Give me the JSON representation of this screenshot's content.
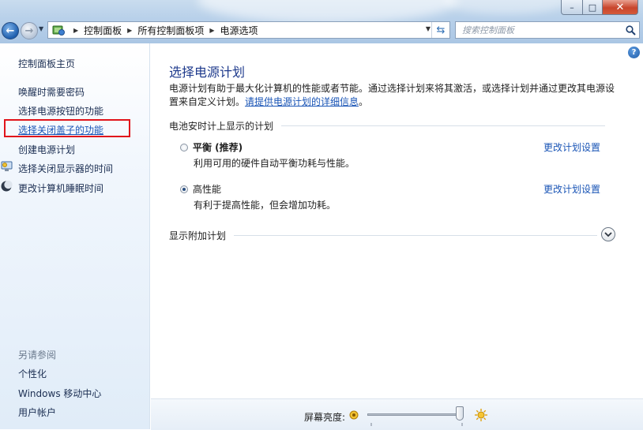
{
  "window": {
    "minimize_label": "–",
    "maximize_label": "□",
    "close_label": "✕"
  },
  "address": {
    "crumbs": [
      "控制面板",
      "所有控制面板项",
      "电源选项"
    ],
    "search_placeholder": "搜索控制面板"
  },
  "sidebar": {
    "home": "控制面板主页",
    "items": [
      "唤醒时需要密码",
      "选择电源按钮的功能",
      "选择关闭盖子的功能",
      "创建电源计划",
      "选择关闭显示器的时间",
      "更改计算机睡眠时间"
    ],
    "highlighted_index": 2,
    "see_also_label": "另请参阅",
    "see_also": [
      "个性化",
      "Windows 移动中心",
      "用户帐户"
    ]
  },
  "main": {
    "title": "选择电源计划",
    "description": "电源计划有助于最大化计算机的性能或者节能。通过选择计划来将其激活，或选择计划并通过更改其电源设置来自定义计划。",
    "description_link": "请提供电源计划的详细信息",
    "description_end": "。",
    "battery_group": "电池安时计上显示的计划",
    "plans": [
      {
        "name": "平衡 (推荐)",
        "desc": "利用可用的硬件自动平衡功耗与性能。",
        "change": "更改计划设置",
        "selected": false
      },
      {
        "name": "高性能",
        "desc": "有利于提高性能，但会增加功耗。",
        "change": "更改计划设置",
        "selected": true
      }
    ],
    "extra_group": "显示附加计划"
  },
  "brightness": {
    "label": "屏幕亮度:",
    "value_fraction": 1.0
  },
  "colors": {
    "link": "#1a55b6",
    "title": "#1e3a8c",
    "highlight_border": "#e1141b"
  }
}
